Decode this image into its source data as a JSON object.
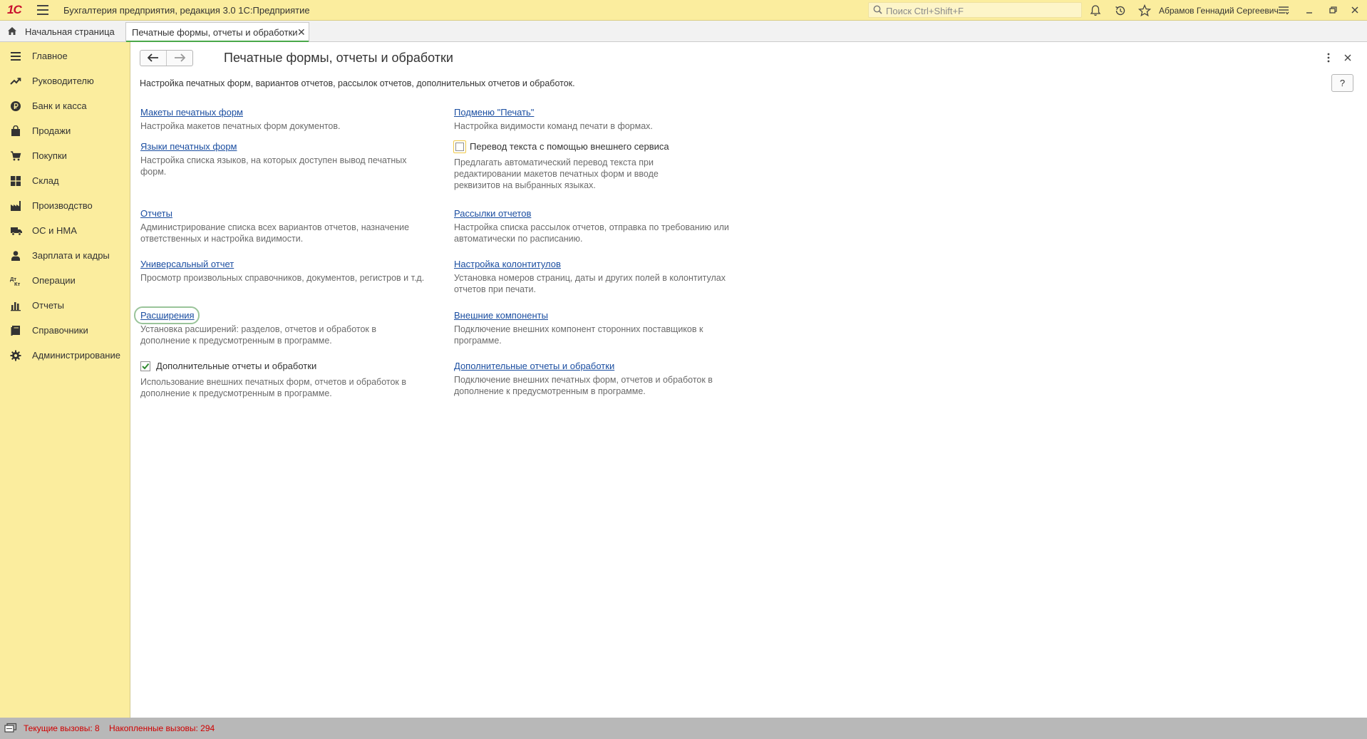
{
  "app": {
    "logo": "1С",
    "title": "Бухгалтерия предприятия, редакция 3.0 1С:Предприятие",
    "search_placeholder": "Поиск Ctrl+Shift+F",
    "user": "Абрамов Геннадий Сергеевич"
  },
  "tabs": {
    "home_label": "Начальная страница",
    "active_label": "Печатные формы, отчеты и обработки",
    "active_close": "✕"
  },
  "sidebar": {
    "items": [
      {
        "label": "Главное",
        "icon": "menu-lines-icon"
      },
      {
        "label": "Руководителю",
        "icon": "trend-up-icon"
      },
      {
        "label": "Банк и касса",
        "icon": "ruble-coin-icon"
      },
      {
        "label": "Продажи",
        "icon": "shopping-bag-icon"
      },
      {
        "label": "Покупки",
        "icon": "cart-icon"
      },
      {
        "label": "Склад",
        "icon": "warehouse-grid-icon"
      },
      {
        "label": "Производство",
        "icon": "factory-icon"
      },
      {
        "label": "ОС и НМА",
        "icon": "truck-icon"
      },
      {
        "label": "Зарплата и кадры",
        "icon": "person-icon"
      },
      {
        "label": "Операции",
        "icon": "dt-kt-icon"
      },
      {
        "label": "Отчеты",
        "icon": "bar-chart-icon"
      },
      {
        "label": "Справочники",
        "icon": "book-icon"
      },
      {
        "label": "Администрирование",
        "icon": "gear-icon"
      }
    ]
  },
  "page": {
    "title": "Печатные формы, отчеты и обработки",
    "description": "Настройка печатных форм, вариантов отчетов, рассылок отчетов, дополнительных отчетов и обработок.",
    "help": "?",
    "left": [
      {
        "link": "Макеты печатных форм",
        "desc": "Настройка макетов печатных форм документов."
      },
      {
        "link": "Языки печатных форм",
        "desc": "Настройка списка языков, на которых доступен вывод печатных форм."
      },
      {
        "link": "Отчеты",
        "desc": "Администрирование списка всех вариантов отчетов, назначение ответственных и настройка видимости."
      },
      {
        "link": "Универсальный отчет",
        "desc": "Просмотр произвольных справочников, документов, регистров и т.д."
      },
      {
        "link": "Расширения",
        "desc": "Установка расширений: разделов, отчетов и обработок в дополнение к предусмотренным в программе."
      },
      {
        "checkbox": "Дополнительные отчеты и обработки",
        "checked": true,
        "desc": "Использование внешних печатных форм, отчетов и обработок в дополнение к предусмотренным в программе."
      }
    ],
    "right": [
      {
        "link": "Подменю \"Печать\"",
        "desc": "Настройка видимости команд печати в формах."
      },
      {
        "checkbox": "Перевод текста с помощью внешнего сервиса",
        "checked": false,
        "desc": "Предлагать автоматический перевод текста при редактировании макетов печатных форм и вводе реквизитов на выбранных языках."
      },
      {
        "link": "Рассылки отчетов",
        "desc": "Настройка списка рассылок отчетов, отправка по требованию или автоматически по расписанию."
      },
      {
        "link": "Настройка колонтитулов",
        "desc": "Установка номеров страниц, даты и других полей в колонтитулах отчетов при печати."
      },
      {
        "link": "Внешние компоненты",
        "desc": "Подключение внешних компонент сторонних поставщиков к программе."
      },
      {
        "link": "Дополнительные отчеты и обработки",
        "desc": "Подключение внешних печатных форм, отчетов и обработок в дополнение к предусмотренным в программе."
      }
    ]
  },
  "status": {
    "text": "Текущие вызовы: 8    Накопленные вызовы: 294",
    "color": "#d00000"
  }
}
